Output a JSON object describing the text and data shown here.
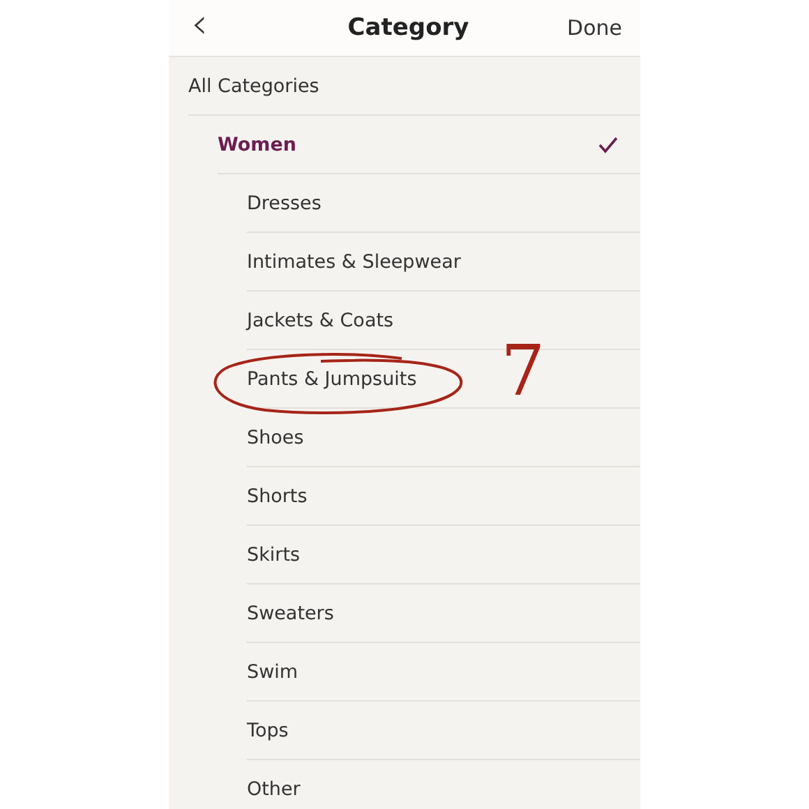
{
  "header": {
    "back": "‹",
    "title": "Category",
    "done": "Done"
  },
  "categories": [
    {
      "label": "All Categories",
      "selected": false,
      "children": [
        {
          "label": "Women",
          "selected": true,
          "children": [
            {
              "label": "Dresses",
              "selected": false
            },
            {
              "label": "Intimates & Sleepwear",
              "selected": false
            },
            {
              "label": "Jackets & Coats",
              "selected": false
            },
            {
              "label": "Pants & Jumpsuits",
              "selected": false,
              "circled": true,
              "note": "7"
            },
            {
              "label": "Shoes",
              "selected": false
            },
            {
              "label": "Shorts",
              "selected": false
            },
            {
              "label": "Skirts",
              "selected": false
            },
            {
              "label": "Sweaters",
              "selected": false
            },
            {
              "label": "Swim",
              "selected": false
            },
            {
              "label": "Tops",
              "selected": false
            },
            {
              "label": "Other",
              "selected": false
            }
          ]
        }
      ]
    }
  ]
}
